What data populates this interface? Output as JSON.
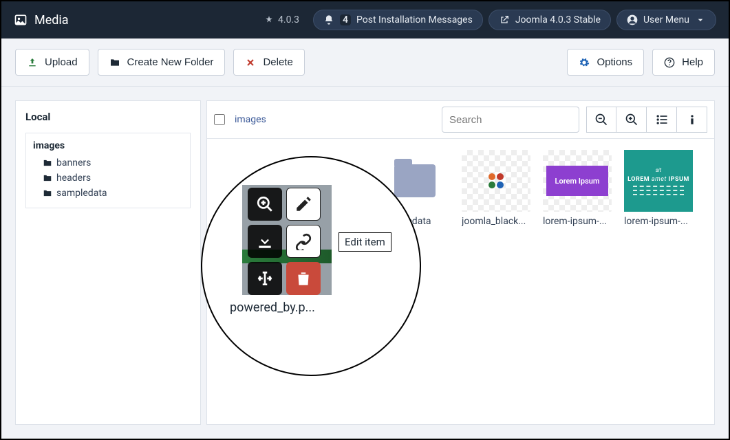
{
  "topbar": {
    "title": "Media",
    "version": "4.0.3",
    "notifications_count": "4",
    "post_install_label": "Post Installation Messages",
    "stable_label": "Joomla 4.0.3 Stable",
    "user_menu_label": "User Menu"
  },
  "toolbar": {
    "upload": "Upload",
    "create_folder": "Create New Folder",
    "delete": "Delete",
    "options": "Options",
    "help": "Help"
  },
  "sidebar": {
    "heading": "Local",
    "root": "images",
    "items": [
      {
        "label": "banners"
      },
      {
        "label": "headers"
      },
      {
        "label": "sampledata"
      }
    ]
  },
  "content": {
    "breadcrumb": "images",
    "search_placeholder": "Search",
    "items": [
      {
        "label": "sampledata"
      },
      {
        "label": "joomla_black..."
      },
      {
        "label": "lorem-ipsum-..."
      },
      {
        "label": "lorem-ipsum-..."
      }
    ]
  },
  "callout": {
    "filename": "powered_by.p...",
    "tooltip": "Edit item"
  },
  "thumb_text": {
    "purple": "Lorem Ipsum",
    "teal_top": "LOREM",
    "teal_right": "IPSUM"
  }
}
